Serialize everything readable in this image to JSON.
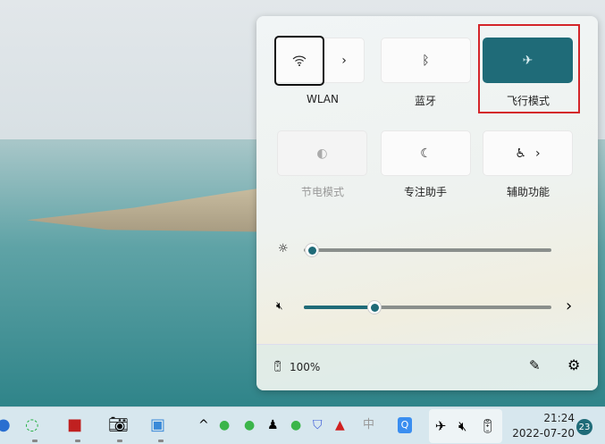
{
  "quick_settings": {
    "tiles": [
      {
        "label": "WLAN",
        "icon": "wifi-icon",
        "state": "off"
      },
      {
        "label": "蓝牙",
        "icon": "bluetooth-icon",
        "state": "off"
      },
      {
        "label": "飞行模式",
        "icon": "airplane-icon",
        "state": "on"
      },
      {
        "label": "节电模式",
        "icon": "battery-saver-icon",
        "state": "disabled"
      },
      {
        "label": "专注助手",
        "icon": "moon-icon",
        "state": "off"
      },
      {
        "label": "辅助功能",
        "icon": "accessibility-icon",
        "state": "off"
      }
    ],
    "brightness_percent": 3,
    "volume_percent": 29,
    "volume_muted": true,
    "battery": "100%"
  },
  "taskbar": {
    "time": "21:24",
    "date": "2022-07-20",
    "notifications": "23"
  },
  "colors": {
    "accent": "#1f6b78",
    "highlight": "#d4252a"
  }
}
